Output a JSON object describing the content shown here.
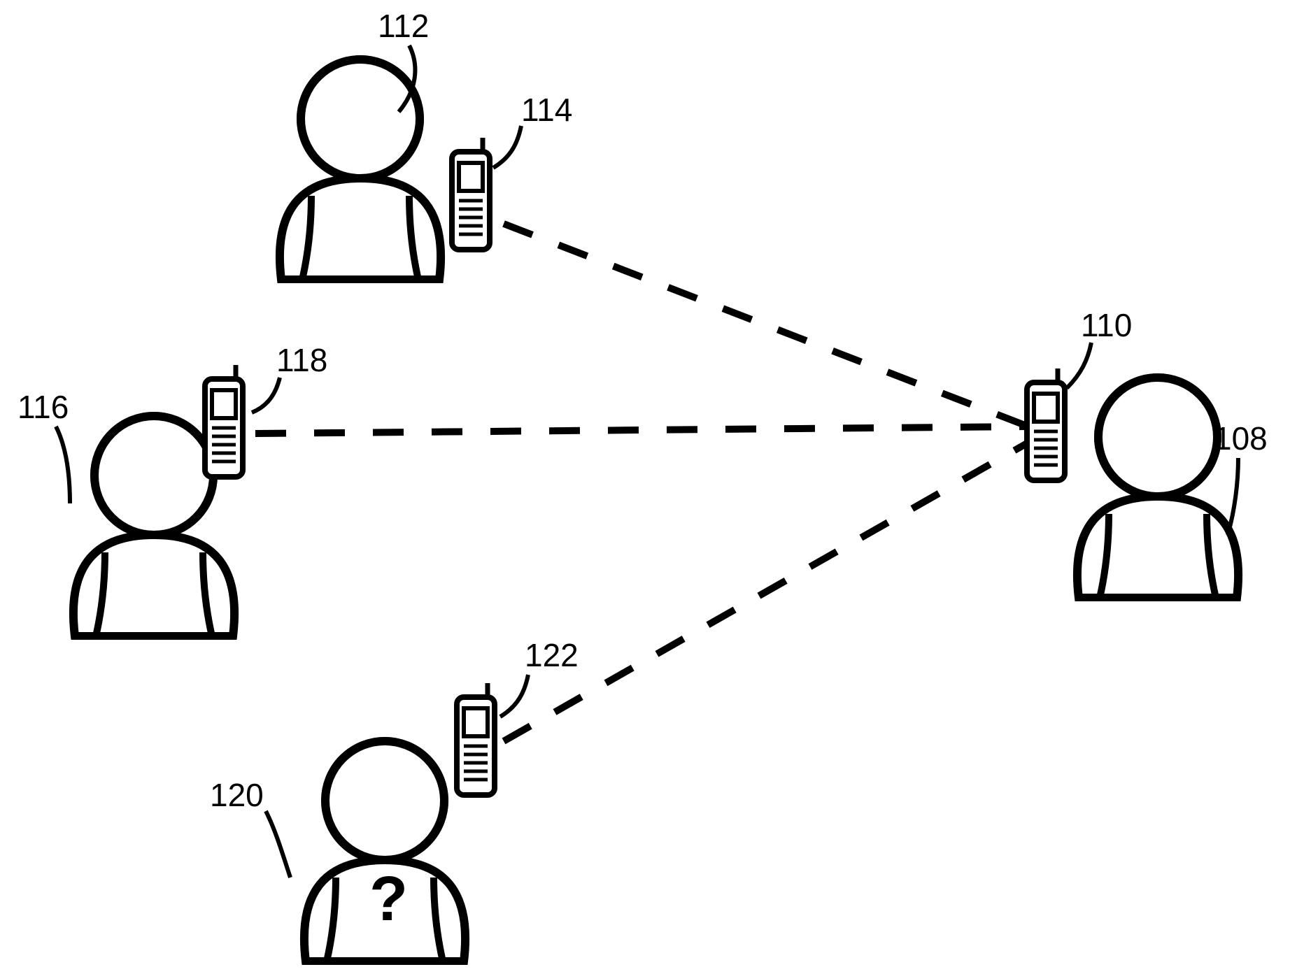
{
  "diagram": {
    "labels": {
      "user_top": "112",
      "phone_top": "114",
      "user_left": "116",
      "phone_left": "118",
      "user_bottom": "120",
      "phone_bottom": "122",
      "user_right": "108",
      "phone_right": "110"
    },
    "unknown_user_symbol": "?"
  },
  "chart_data": {
    "type": "diagram",
    "title": "",
    "nodes": [
      {
        "id": "112",
        "type": "user",
        "approx_pos": "top-left"
      },
      {
        "id": "114",
        "type": "phone",
        "approx_pos": "top-left",
        "belongs_to": "112"
      },
      {
        "id": "116",
        "type": "user",
        "approx_pos": "mid-left"
      },
      {
        "id": "118",
        "type": "phone",
        "approx_pos": "mid-left",
        "belongs_to": "116"
      },
      {
        "id": "120",
        "type": "user",
        "approx_pos": "bottom",
        "unknown": true
      },
      {
        "id": "122",
        "type": "phone",
        "approx_pos": "bottom",
        "belongs_to": "120"
      },
      {
        "id": "108",
        "type": "user",
        "approx_pos": "right"
      },
      {
        "id": "110",
        "type": "phone",
        "approx_pos": "right",
        "belongs_to": "108"
      }
    ],
    "edges": [
      {
        "from": "114",
        "to": "110",
        "style": "dashed"
      },
      {
        "from": "118",
        "to": "110",
        "style": "dashed"
      },
      {
        "from": "122",
        "to": "110",
        "style": "dashed"
      }
    ]
  }
}
